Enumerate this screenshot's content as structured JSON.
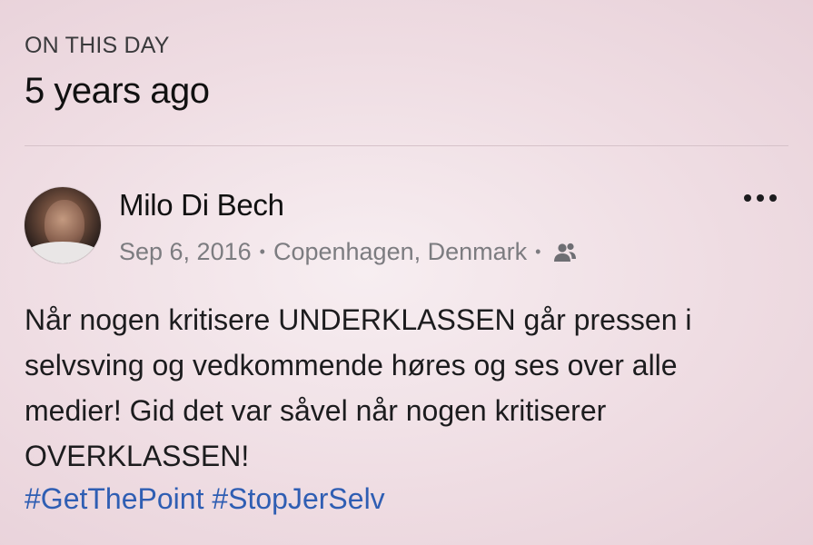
{
  "header": {
    "label": "ON THIS DAY",
    "title": "5 years ago"
  },
  "post": {
    "author": "Milo Di Bech",
    "date": "Sep 6, 2016",
    "separator": "•",
    "location": "Copenhagen, Denmark",
    "audience_icon": "friends-icon",
    "more_icon": "more-options-icon",
    "text_lines": [
      "Når nogen kritisere UNDERKLASSEN går pressen i",
      "selvsving og vedkommende høres og ses over alle",
      "medier! Gid det var såvel når nogen kritiserer",
      "OVERKLASSEN!"
    ],
    "hashtags": [
      "#GetThePoint",
      "#StopJerSelv"
    ]
  },
  "colors": {
    "hashtag": "#2f5eb3",
    "meta_text": "#7c7c80",
    "background": "#f0e0e6"
  }
}
